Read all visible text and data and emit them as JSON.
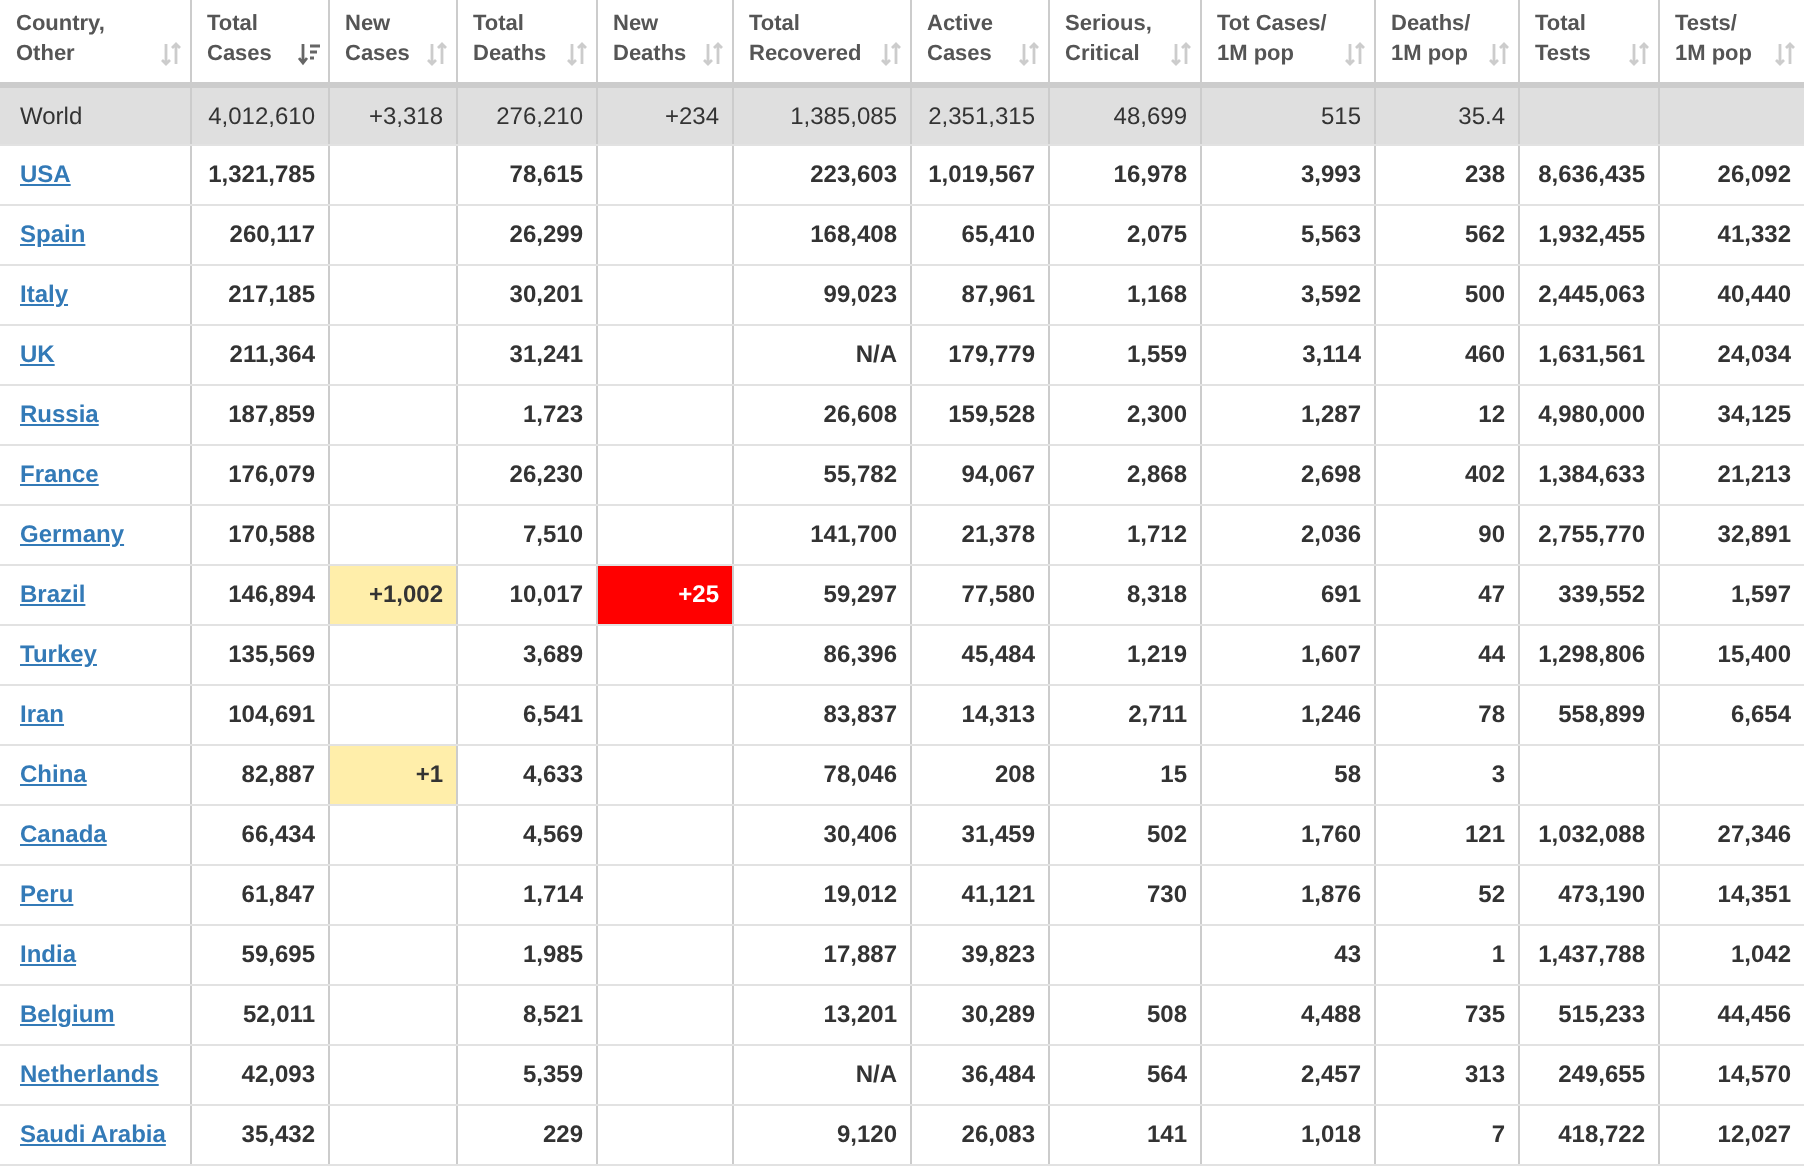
{
  "table": {
    "columns": [
      {
        "label": "Country,\nOther",
        "sorted": false
      },
      {
        "label": "Total\nCases",
        "sorted": true
      },
      {
        "label": "New\nCases",
        "sorted": false
      },
      {
        "label": "Total\nDeaths",
        "sorted": false
      },
      {
        "label": "New\nDeaths",
        "sorted": false
      },
      {
        "label": "Total\nRecovered",
        "sorted": false
      },
      {
        "label": "Active\nCases",
        "sorted": false
      },
      {
        "label": "Serious,\nCritical",
        "sorted": false
      },
      {
        "label": "Tot Cases/\n1M pop",
        "sorted": false
      },
      {
        "label": "Deaths/\n1M pop",
        "sorted": false
      },
      {
        "label": "Total\nTests",
        "sorted": false
      },
      {
        "label": "Tests/\n1M pop",
        "sorted": false
      }
    ],
    "rows": [
      {
        "kind": "total",
        "cells": [
          "World",
          "4,012,610",
          "+3,318",
          "276,210",
          "+234",
          "1,385,085",
          "2,351,315",
          "48,699",
          "515",
          "35.4",
          "",
          ""
        ]
      },
      {
        "kind": "country",
        "cells": [
          "USA",
          "1,321,785",
          "",
          "78,615",
          "",
          "223,603",
          "1,019,567",
          "16,978",
          "3,993",
          "238",
          "8,636,435",
          "26,092"
        ]
      },
      {
        "kind": "country",
        "cells": [
          "Spain",
          "260,117",
          "",
          "26,299",
          "",
          "168,408",
          "65,410",
          "2,075",
          "5,563",
          "562",
          "1,932,455",
          "41,332"
        ]
      },
      {
        "kind": "country",
        "cells": [
          "Italy",
          "217,185",
          "",
          "30,201",
          "",
          "99,023",
          "87,961",
          "1,168",
          "3,592",
          "500",
          "2,445,063",
          "40,440"
        ]
      },
      {
        "kind": "country",
        "cells": [
          "UK",
          "211,364",
          "",
          "31,241",
          "",
          "N/A",
          "179,779",
          "1,559",
          "3,114",
          "460",
          "1,631,561",
          "24,034"
        ]
      },
      {
        "kind": "country",
        "cells": [
          "Russia",
          "187,859",
          "",
          "1,723",
          "",
          "26,608",
          "159,528",
          "2,300",
          "1,287",
          "12",
          "4,980,000",
          "34,125"
        ]
      },
      {
        "kind": "country",
        "cells": [
          "France",
          "176,079",
          "",
          "26,230",
          "",
          "55,782",
          "94,067",
          "2,868",
          "2,698",
          "402",
          "1,384,633",
          "21,213"
        ]
      },
      {
        "kind": "country",
        "cells": [
          "Germany",
          "170,588",
          "",
          "7,510",
          "",
          "141,700",
          "21,378",
          "1,712",
          "2,036",
          "90",
          "2,755,770",
          "32,891"
        ]
      },
      {
        "kind": "country",
        "cells": [
          "Brazil",
          "146,894",
          {
            "text": "+1,002",
            "kind": "new-cases"
          },
          "10,017",
          {
            "text": "+25",
            "kind": "new-deaths"
          },
          "59,297",
          "77,580",
          "8,318",
          "691",
          "47",
          "339,552",
          "1,597"
        ]
      },
      {
        "kind": "country",
        "cells": [
          "Turkey",
          "135,569",
          "",
          "3,689",
          "",
          "86,396",
          "45,484",
          "1,219",
          "1,607",
          "44",
          "1,298,806",
          "15,400"
        ]
      },
      {
        "kind": "country",
        "cells": [
          "Iran",
          "104,691",
          "",
          "6,541",
          "",
          "83,837",
          "14,313",
          "2,711",
          "1,246",
          "78",
          "558,899",
          "6,654"
        ]
      },
      {
        "kind": "country",
        "cells": [
          "China",
          "82,887",
          {
            "text": "+1",
            "kind": "new-cases"
          },
          "4,633",
          "",
          "78,046",
          "208",
          "15",
          "58",
          "3",
          "",
          ""
        ]
      },
      {
        "kind": "country",
        "cells": [
          "Canada",
          "66,434",
          "",
          "4,569",
          "",
          "30,406",
          "31,459",
          "502",
          "1,760",
          "121",
          "1,032,088",
          "27,346"
        ]
      },
      {
        "kind": "country",
        "cells": [
          "Peru",
          "61,847",
          "",
          "1,714",
          "",
          "19,012",
          "41,121",
          "730",
          "1,876",
          "52",
          "473,190",
          "14,351"
        ]
      },
      {
        "kind": "country",
        "cells": [
          "India",
          "59,695",
          "",
          "1,985",
          "",
          "17,887",
          "39,823",
          "",
          "43",
          "1",
          "1,437,788",
          "1,042"
        ]
      },
      {
        "kind": "country",
        "cells": [
          "Belgium",
          "52,011",
          "",
          "8,521",
          "",
          "13,201",
          "30,289",
          "508",
          "4,488",
          "735",
          "515,233",
          "44,456"
        ]
      },
      {
        "kind": "country",
        "cells": [
          "Netherlands",
          "42,093",
          "",
          "5,359",
          "",
          "N/A",
          "36,484",
          "564",
          "2,457",
          "313",
          "249,655",
          "14,570"
        ]
      },
      {
        "kind": "country",
        "cells": [
          "Saudi Arabia",
          "35,432",
          "",
          "229",
          "",
          "9,120",
          "26,083",
          "141",
          "1,018",
          "7",
          "418,722",
          "12,027"
        ]
      }
    ]
  }
}
